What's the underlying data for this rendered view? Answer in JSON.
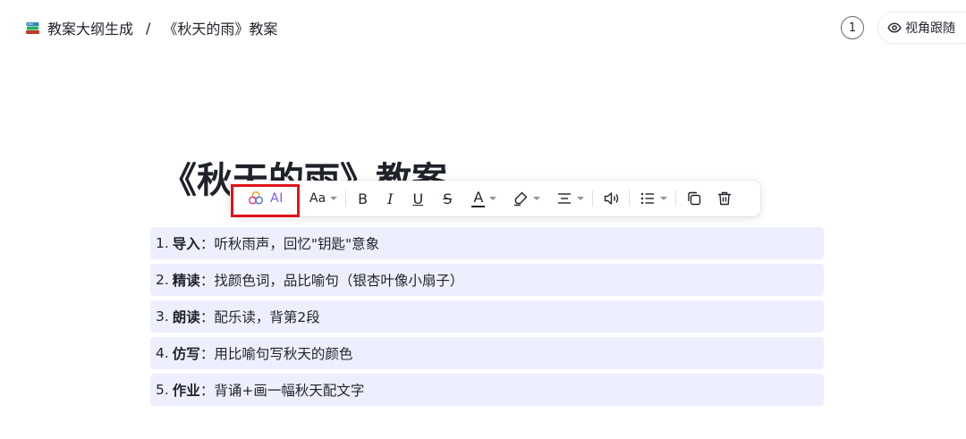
{
  "breadcrumb": {
    "icon": "stacked-books-icon",
    "parent": "教案大纲生成",
    "separator": "/",
    "current": "《秋天的雨》教案"
  },
  "header": {
    "counter": "1",
    "follow_label": "视角跟随",
    "follow_icon": "eye-icon"
  },
  "document": {
    "title": "《秋天的雨》教案",
    "items": [
      {
        "num": "1.",
        "key": "导入",
        "sep": "：",
        "text": "听秋雨声，回忆\"钥匙\"意象"
      },
      {
        "num": "2.",
        "key": "精读",
        "sep": "：",
        "text": "找颜色词，品比喻句（银杏叶像小扇子）"
      },
      {
        "num": "3.",
        "key": "朗读",
        "sep": "：",
        "text": "配乐读，背第2段"
      },
      {
        "num": "4.",
        "key": "仿写",
        "sep": "：",
        "text": "用比喻句写秋天的颜色"
      },
      {
        "num": "5.",
        "key": "作业",
        "sep": "：",
        "text": "背诵+画一幅秋天配文字"
      }
    ]
  },
  "toolbar": {
    "ai_label": "AI",
    "font_size_label": "Aa",
    "bold": "B",
    "italic": "I",
    "underline": "U",
    "strike": "S",
    "text_color": "A",
    "highlight_color": "#e0141a",
    "accent": "#7b5cf0"
  }
}
